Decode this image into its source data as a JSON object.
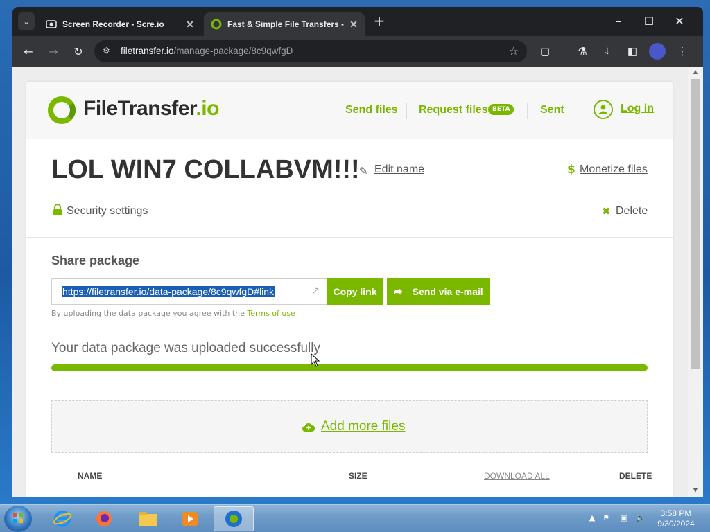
{
  "browser": {
    "tabs": [
      {
        "title": "Screen Recorder - Scre.io",
        "active": false
      },
      {
        "title": "Fast & Simple File Transfers - F",
        "active": true
      }
    ],
    "url_host": "filetransfer.io",
    "url_path": "/manage-package/8c9qwfgD",
    "new_tab_symbol": "+",
    "icons": [
      "chevron-down-icon",
      "back-icon",
      "forward-icon",
      "reload-icon",
      "site-info-icon",
      "star-icon",
      "extensions-icon",
      "labs-icon",
      "download-icon",
      "sidebar-icon",
      "profile-icon",
      "menu-icon"
    ]
  },
  "site": {
    "logo_main": "FileTransfer",
    "logo_tld": ".io",
    "nav": {
      "send_files": "Send files",
      "request_files": "Request files",
      "beta": "BETA",
      "sent": "Sent",
      "login": "Log in"
    },
    "accent_color": "#7ab800"
  },
  "package": {
    "title": "LOL WIN7 COLLABVM!!!",
    "edit_name": "Edit name",
    "monetize": "Monetize files",
    "security": "Security settings",
    "delete": "Delete"
  },
  "share": {
    "title": "Share package",
    "link": "https://filetransfer.io/data-package/8c9qwfgD#link",
    "copy_link": "Copy link",
    "send_email": "Send via e-mail",
    "terms_prefix": "By uploading the data package you agree with the",
    "terms_link": "Terms of use"
  },
  "upload": {
    "status": "Your data package was uploaded successfully",
    "progress_percent": 100,
    "add_more": "Add more files"
  },
  "table": {
    "col_name": "NAME",
    "col_size": "SIZE",
    "col_download_all": "DOWNLOAD ALL",
    "col_delete": "DELETE"
  },
  "taskbar": {
    "time": "3:58 PM",
    "date": "9/30/2024",
    "apps": [
      "internet-explorer",
      "firefox",
      "file-explorer",
      "media-player",
      "chrome"
    ]
  }
}
